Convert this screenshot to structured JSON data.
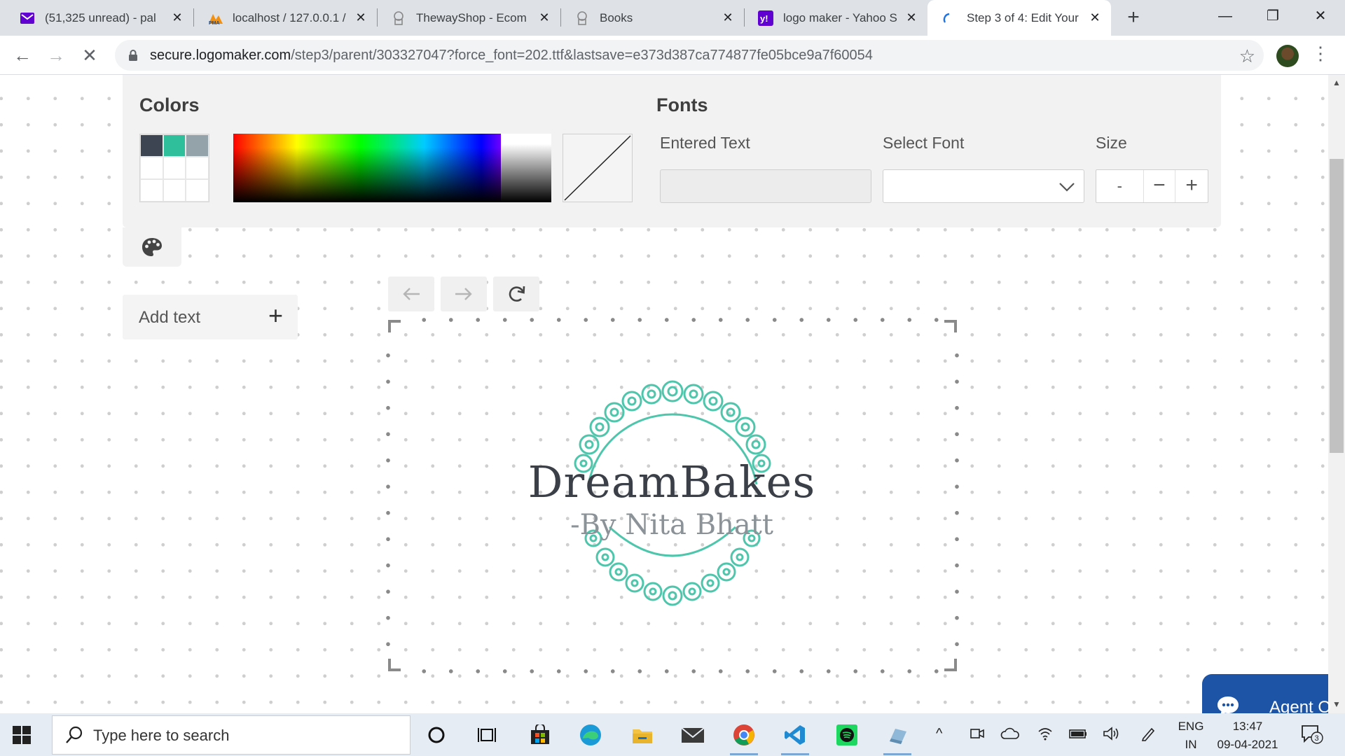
{
  "browser": {
    "tabs": [
      {
        "title": "(51,325 unread) - pal",
        "icon": "yahoo-mail-icon",
        "active": false
      },
      {
        "title": "localhost / 127.0.0.1 /",
        "icon": "phpmyadmin-icon",
        "active": false
      },
      {
        "title": "ThewayShop - Ecom",
        "icon": "page-icon",
        "active": false
      },
      {
        "title": "Books",
        "icon": "page-icon",
        "active": false
      },
      {
        "title": "logo maker - Yahoo S",
        "icon": "yahoo-icon",
        "active": false
      },
      {
        "title": "Step 3 of 4: Edit Your",
        "icon": "loading-icon",
        "active": true
      }
    ],
    "url_host": "secure.logomaker.com",
    "url_path": "/step3/parent/303327047?force_font=202.ttf&lastsave=e373d387ca774877fe05bce9a7f60054"
  },
  "editor": {
    "colors_heading": "Colors",
    "fonts_heading": "Fonts",
    "swatches": [
      "#3d4552",
      "#2fbf9a",
      "#94a2aa"
    ],
    "entered_text_label": "Entered Text",
    "entered_text_value": "",
    "select_font_label": "Select Font",
    "select_font_value": "",
    "size_label": "Size",
    "size_value": "-",
    "size_decrease": "−",
    "size_increase": "+",
    "add_text_label": "Add text",
    "add_text_plus": "+"
  },
  "logo": {
    "title": "DreamBakes",
    "subtitle": "-By Nita Bhatt",
    "accent_color": "#4fc6ac",
    "text_color": "#3a3f48"
  },
  "chat": {
    "label": "Agent O"
  },
  "taskbar": {
    "search_placeholder": "Type here to search",
    "lang_top": "ENG",
    "lang_bottom": "IN",
    "time": "13:47",
    "date": "09-04-2021",
    "notification_count": "3"
  }
}
